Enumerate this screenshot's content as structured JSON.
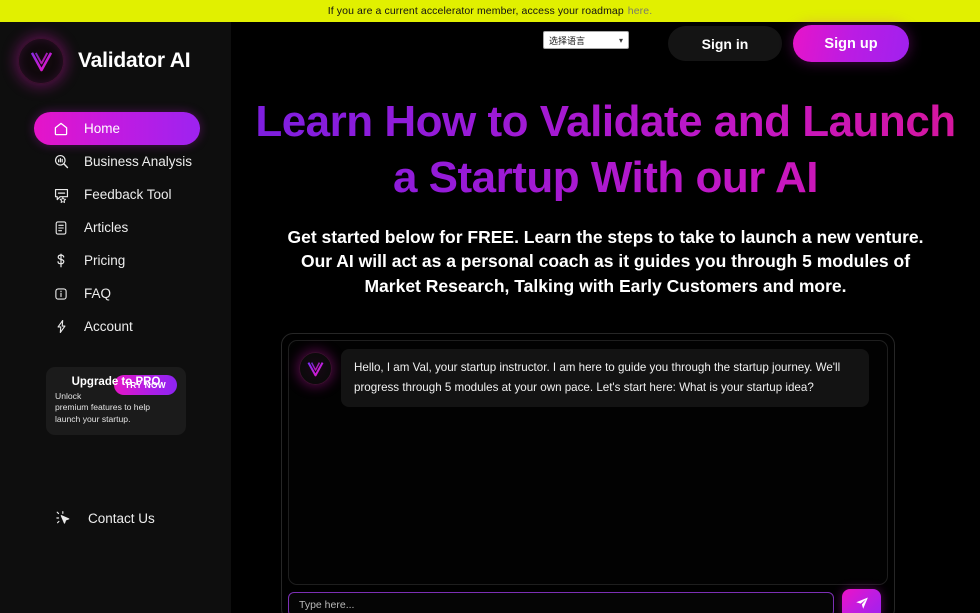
{
  "banner": {
    "text": "If you are a current accelerator member, access your roadmap",
    "link_text": "here.",
    "bg_color": "#e1f000"
  },
  "sidebar": {
    "brand": {
      "name": "Validator AI",
      "logo_icon": "validator-v-logo"
    },
    "items": [
      {
        "label": "Home",
        "icon": "home-icon",
        "active": true
      },
      {
        "label": "Business Analysis",
        "icon": "magnifier-chart-icon",
        "active": false
      },
      {
        "label": "Feedback Tool",
        "icon": "speech-bubble-star-icon",
        "active": false
      },
      {
        "label": "Articles",
        "icon": "document-lines-icon",
        "active": false
      },
      {
        "label": "Pricing",
        "icon": "dollar-sign-icon",
        "active": false
      },
      {
        "label": "FAQ",
        "icon": "info-square-icon",
        "active": false
      },
      {
        "label": "Account",
        "icon": "lightning-bolt-icon",
        "active": false
      }
    ],
    "upgrade_card": {
      "title": "Upgrade to PRO",
      "description": "Unlock premium features to help launch your startup.",
      "button_label": "TRY NOW"
    },
    "contact": {
      "label": "Contact Us",
      "icon": "cursor-click-icon"
    },
    "accent_gradient_from": "#e614c8",
    "accent_gradient_to": "#9d23f0"
  },
  "header": {
    "language_select": {
      "value": "选择语言",
      "chevron_icon": "chevron-down-icon"
    },
    "sign_in_label": "Sign in",
    "sign_up_label": "Sign up"
  },
  "hero": {
    "heading": "Learn How to Validate and Launch a Startup With our AI",
    "subheading": "Get started below for FREE. Learn the steps to take to launch a new venture. Our AI will act as a personal coach as it guides you through 5 modules of Market Research, Talking with Early Customers and more."
  },
  "chat": {
    "avatar_icon": "validator-v-logo",
    "message": "Hello, I am Val, your startup instructor.  I am here to guide you through the startup journey. We'll progress through 5 modules at your own pace. Let's start here:  What is your startup idea?",
    "input_placeholder": "Type here...",
    "input_value": "",
    "send_icon": "paper-plane-icon"
  }
}
